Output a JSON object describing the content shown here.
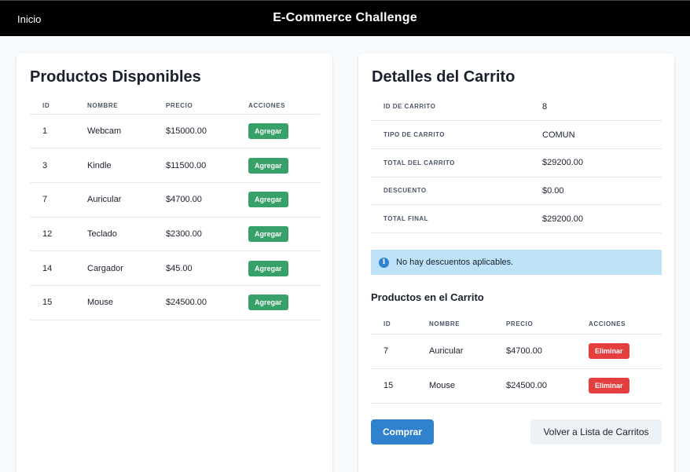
{
  "nav": {
    "home_label": "Inicio",
    "title": "E-Commerce Challenge"
  },
  "products": {
    "heading": "Productos Disponibles",
    "columns": [
      "ID",
      "NOMBRE",
      "PRECIO",
      "ACCIONES"
    ],
    "rows": [
      {
        "id": "1",
        "name": "Webcam",
        "price": "$15000.00",
        "action": "Agregar"
      },
      {
        "id": "3",
        "name": "Kindle",
        "price": "$11500.00",
        "action": "Agregar"
      },
      {
        "id": "7",
        "name": "Auricular",
        "price": "$4700.00",
        "action": "Agregar"
      },
      {
        "id": "12",
        "name": "Teclado",
        "price": "$2300.00",
        "action": "Agregar"
      },
      {
        "id": "14",
        "name": "Cargador",
        "price": "$45.00",
        "action": "Agregar"
      },
      {
        "id": "15",
        "name": "Mouse",
        "price": "$24500.00",
        "action": "Agregar"
      }
    ]
  },
  "cart": {
    "heading": "Detalles del Carrito",
    "details": [
      {
        "label": "ID DE CARRITO",
        "value": "8"
      },
      {
        "label": "TIPO DE CARRITO",
        "value": "COMUN"
      },
      {
        "label": "TOTAL DEL CARRITO",
        "value": "$29200.00"
      },
      {
        "label": "DESCUENTO",
        "value": "$0.00"
      },
      {
        "label": "TOTAL FINAL",
        "value": "$29200.00"
      }
    ],
    "alert": {
      "icon": "info-icon",
      "text": "No hay descuentos aplicables."
    },
    "items_heading": "Productos en el Carrito",
    "columns": [
      "ID",
      "NOMBRE",
      "PRECIO",
      "ACCIONES"
    ],
    "items": [
      {
        "id": "7",
        "name": "Auricular",
        "price": "$4700.00",
        "action": "Eliminar"
      },
      {
        "id": "15",
        "name": "Mouse",
        "price": "$24500.00",
        "action": "Eliminar"
      }
    ],
    "buy_label": "Comprar",
    "back_label": "Volver a Lista de Carritos"
  },
  "colors": {
    "add": "#38a169",
    "remove": "#e53e3e",
    "primary": "#3182ce",
    "alert_bg": "#bee3f8"
  }
}
